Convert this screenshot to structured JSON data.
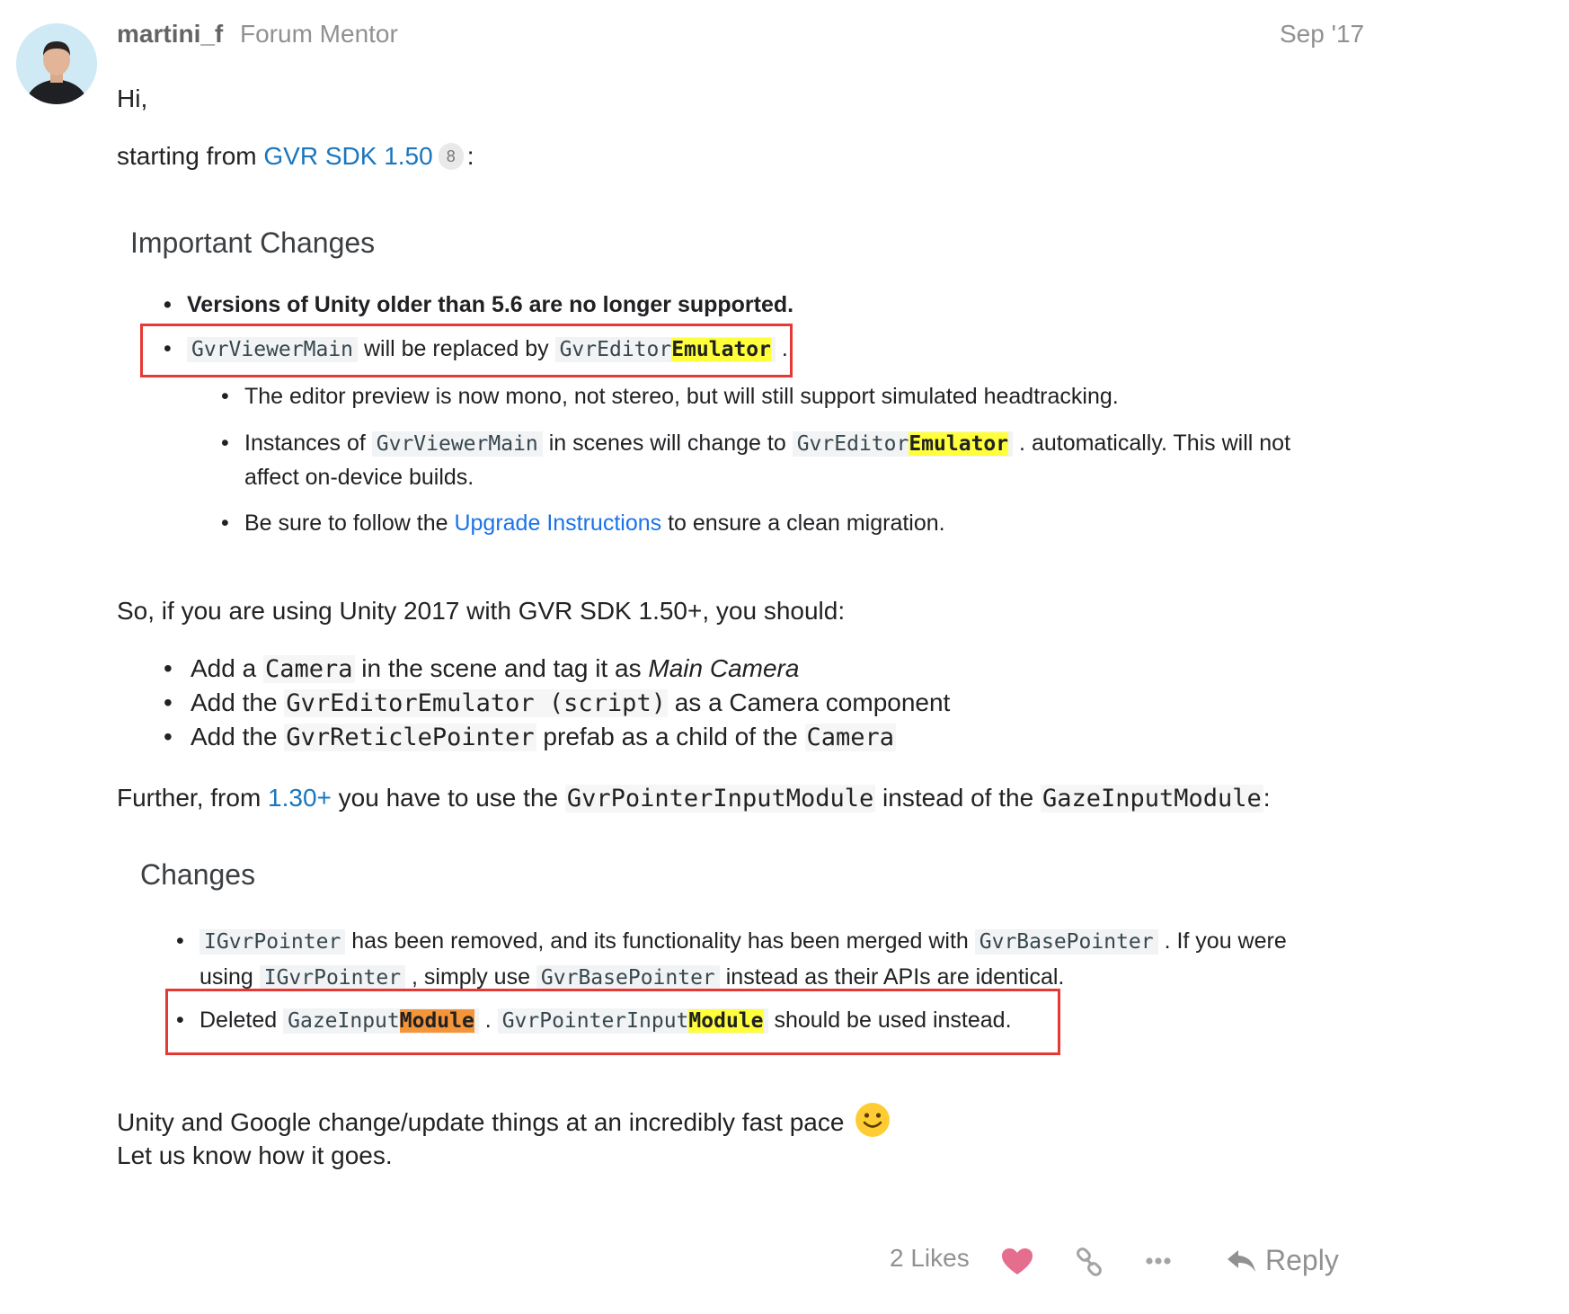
{
  "post": {
    "username": "martini_f",
    "user_title": "Forum Mentor",
    "date": "Sep '17",
    "greeting": "Hi,",
    "intro_pre": "starting from ",
    "intro_link": "GVR SDK 1.50",
    "intro_link_count": "8",
    "intro_post": ":",
    "shot1": {
      "heading": "Important Changes",
      "line1": "Versions of Unity older than 5.6 are no longer supported.",
      "line2_code1": "GvrViewerMain",
      "line2_mid": " will be replaced by ",
      "line2_code2_a": "GvrEditor",
      "line2_code2_b": "Emulator",
      "line2_end": " .",
      "sub1": "The editor preview is now mono, not stereo, but will still support simulated headtracking.",
      "sub2_pre": "Instances of ",
      "sub2_code1": "GvrViewerMain",
      "sub2_mid": " in scenes will change to ",
      "sub2_code2_a": "GvrEditor",
      "sub2_code2_b": "Emulator",
      "sub2_post": " . automatically. This will not",
      "sub2_line2": "affect on-device builds.",
      "sub3_pre": "Be sure to follow the ",
      "sub3_link": "Upgrade Instructions",
      "sub3_post": " to ensure a clean migration."
    },
    "para2": "So, if you are using Unity 2017 with GVR SDK 1.50+, you should:",
    "list": {
      "item1_pre": "Add a ",
      "item1_code": "Camera",
      "item1_mid": " in the scene and tag it as ",
      "item1_em": "Main Camera",
      "item2_pre": "Add the ",
      "item2_code": "GvrEditorEmulator (script)",
      "item2_post": " as a Camera component",
      "item3_pre": "Add the ",
      "item3_code": "GvrReticlePointer",
      "item3_mid": " prefab as a child of the ",
      "item3_code2": "Camera"
    },
    "para3": {
      "pre": "Further, from ",
      "link": "1.30+",
      "mid": " you have to use the ",
      "code1": "GvrPointerInputModule",
      "mid2": " instead of the ",
      "code2": "GazeInputModule",
      "post": ":"
    },
    "shot2": {
      "heading": "Changes",
      "l1_code1": "IGvrPointer",
      "l1_mid": " has been removed, and its functionality has been merged with ",
      "l1_code2": "GvrBasePointer",
      "l1_post": " . If you were",
      "l2_pre": "using ",
      "l2_code1": "IGvrPointer",
      "l2_mid": " , simply use ",
      "l2_code2": "GvrBasePointer",
      "l2_post": " instead as their APIs are identical.",
      "l3_pre": "Deleted ",
      "l3_code1_a": "GazeInput",
      "l3_code1_b": "Module",
      "l3_dot": " . ",
      "l3_code2_a": "GvrPointerInput",
      "l3_code2_b": "Module",
      "l3_post": " should be used instead."
    },
    "closing1": "Unity and Google change/update things at an incredibly fast pace",
    "closing2": "Let us know how it goes."
  },
  "actions": {
    "likes": "2 Likes",
    "reply": "Reply"
  },
  "colors": {
    "link": "#1a76bd",
    "heart": "#e56d8e",
    "highlight_yellow": "#ffff3b",
    "highlight_orange": "#f5953a",
    "red_box": "#e53935"
  },
  "icons": [
    "avatar-photo",
    "heart-icon",
    "link-icon",
    "more-icon",
    "reply-icon",
    "smiley-emoji"
  ]
}
